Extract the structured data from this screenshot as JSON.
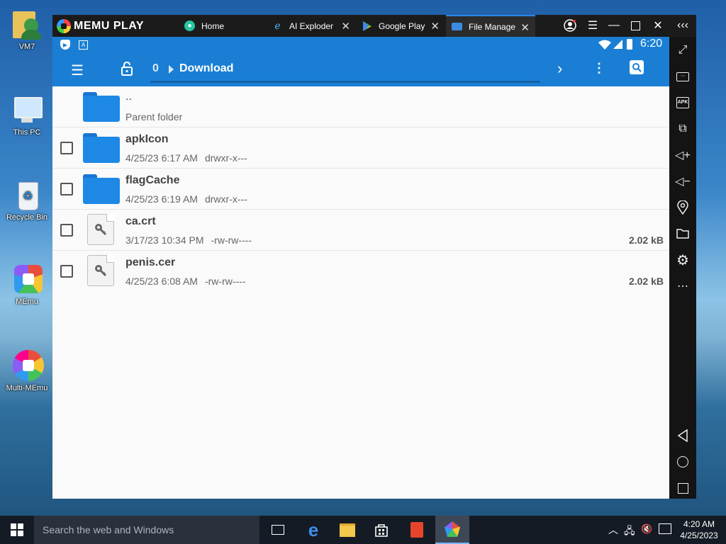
{
  "desktop": {
    "icons": [
      {
        "label": "VM7",
        "icon": "user-folder-icon"
      },
      {
        "label": "This PC",
        "icon": "computer-icon"
      },
      {
        "label": "Recycle Bin",
        "icon": "recycle-bin-icon"
      },
      {
        "label": "MEmu",
        "icon": "memu-icon"
      },
      {
        "label": "Multi-MEmu",
        "icon": "multi-memu-icon"
      }
    ]
  },
  "emulator": {
    "logo_text": "MEMU PLAY",
    "tabs": [
      {
        "label": "Home",
        "icon": "home-app-icon",
        "closable": false
      },
      {
        "label": "AI Exploder",
        "icon": "ai-exploder-icon",
        "closable": true
      },
      {
        "label": "Google Play",
        "icon": "google-play-icon",
        "closable": true
      },
      {
        "label": "File Manage",
        "icon": "file-manager-icon",
        "closable": true,
        "active": true
      }
    ],
    "controls": [
      "account-icon",
      "menu-icon",
      "minimize-icon",
      "maximize-icon",
      "close-icon",
      "collapse-sidebar-icon"
    ]
  },
  "android": {
    "status_time": "6:20",
    "status_icons": [
      "play-protect-icon",
      "a-icon",
      "wifi-icon",
      "signal-icon",
      "battery-icon"
    ],
    "breadcrumb": {
      "count": "0",
      "folder": "Download"
    },
    "items": [
      {
        "name": "..",
        "meta": [
          "Parent folder"
        ],
        "size": "",
        "type": "parent",
        "checkbox": false
      },
      {
        "name": "apkIcon",
        "meta": [
          "4/25/23 6:17 AM",
          "drwxr-x---"
        ],
        "size": "",
        "type": "folder",
        "checkbox": true
      },
      {
        "name": "flagCache",
        "meta": [
          "4/25/23 6:19 AM",
          "drwxr-x---"
        ],
        "size": "",
        "type": "folder",
        "checkbox": true
      },
      {
        "name": "ca.crt",
        "meta": [
          "3/17/23 10:34 PM",
          "-rw-rw----"
        ],
        "size": "2.02 kB",
        "type": "file",
        "checkbox": true
      },
      {
        "name": "penis.cer",
        "meta": [
          "4/25/23 6:08 AM",
          "-rw-rw----"
        ],
        "size": "2.02 kB",
        "type": "file",
        "checkbox": true
      }
    ],
    "colors": {
      "primary": "#1a7fd4",
      "folder": "#1e88e5"
    }
  },
  "sidebar_tools": [
    "fullscreen-icon",
    "keyboard-icon",
    "apk-icon",
    "multi-window-icon",
    "volume-up-icon",
    "volume-down-icon",
    "location-icon",
    "folder-icon",
    "settings-icon",
    "more-icon",
    "back-icon",
    "home-icon",
    "recents-icon"
  ],
  "taskbar": {
    "search_placeholder": "Search the web and Windows",
    "apps": [
      "task-view-icon",
      "edge-icon",
      "file-explorer-icon",
      "store-icon",
      "office-icon",
      "memu-icon"
    ],
    "time": "4:20 AM",
    "date": "4/25/2023"
  }
}
